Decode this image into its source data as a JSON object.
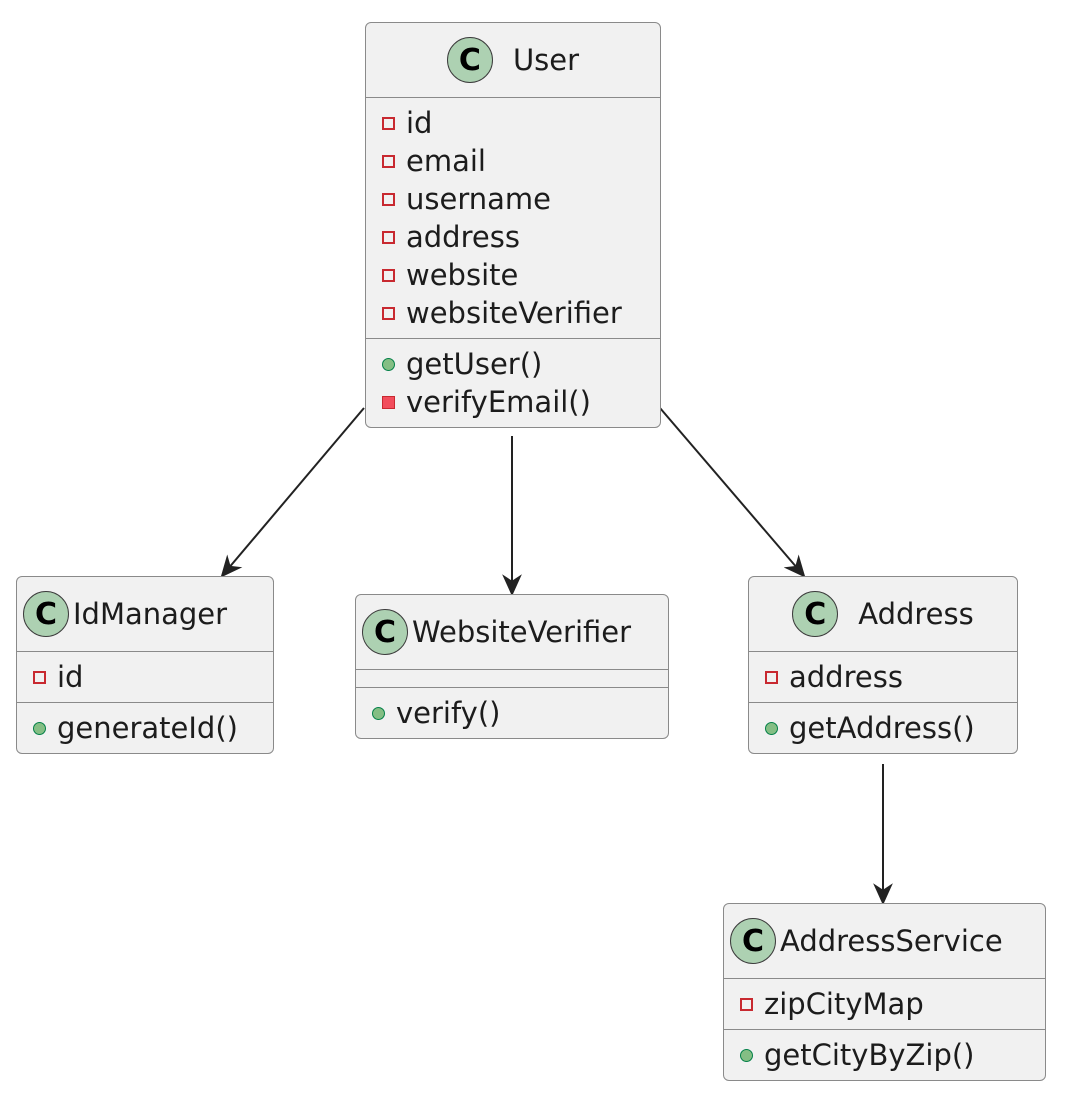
{
  "diagram": {
    "type": "uml-class-diagram",
    "classes": [
      {
        "id": "user",
        "name": "User",
        "stereotype_icon": "C",
        "fields": [
          {
            "visibility": "private",
            "name": "id"
          },
          {
            "visibility": "private",
            "name": "email"
          },
          {
            "visibility": "private",
            "name": "username"
          },
          {
            "visibility": "private",
            "name": "address"
          },
          {
            "visibility": "private",
            "name": "website"
          },
          {
            "visibility": "private",
            "name": "websiteVerifier"
          }
        ],
        "methods": [
          {
            "visibility": "public",
            "name": "getUser()"
          },
          {
            "visibility": "private",
            "name": "verifyEmail()"
          }
        ]
      },
      {
        "id": "idmanager",
        "name": "IdManager",
        "stereotype_icon": "C",
        "fields": [
          {
            "visibility": "private",
            "name": "id"
          }
        ],
        "methods": [
          {
            "visibility": "public",
            "name": "generateId()"
          }
        ]
      },
      {
        "id": "websiteverifier",
        "name": "WebsiteVerifier",
        "stereotype_icon": "C",
        "fields": [],
        "methods": [
          {
            "visibility": "public",
            "name": "verify()"
          }
        ]
      },
      {
        "id": "address",
        "name": "Address",
        "stereotype_icon": "C",
        "fields": [
          {
            "visibility": "private",
            "name": "address"
          }
        ],
        "methods": [
          {
            "visibility": "public",
            "name": "getAddress()"
          }
        ]
      },
      {
        "id": "addressservice",
        "name": "AddressService",
        "stereotype_icon": "C",
        "fields": [
          {
            "visibility": "private",
            "name": "zipCityMap"
          }
        ],
        "methods": [
          {
            "visibility": "public",
            "name": "getCityByZip()"
          }
        ]
      }
    ],
    "relations": [
      {
        "from": "User",
        "to": "IdManager",
        "type": "association-arrow"
      },
      {
        "from": "User",
        "to": "WebsiteVerifier",
        "type": "association-arrow"
      },
      {
        "from": "User",
        "to": "Address",
        "type": "association-arrow"
      },
      {
        "from": "Address",
        "to": "AddressService",
        "type": "association-arrow"
      }
    ],
    "colors": {
      "class_fill": "#f1f1f1",
      "class_border": "#8a8a8a",
      "class_badge": "#add1b2",
      "private_marker": "#c82930",
      "private_method_fill": "#f24d5c",
      "public_marker": "#84be84",
      "edge": "#222222"
    }
  }
}
